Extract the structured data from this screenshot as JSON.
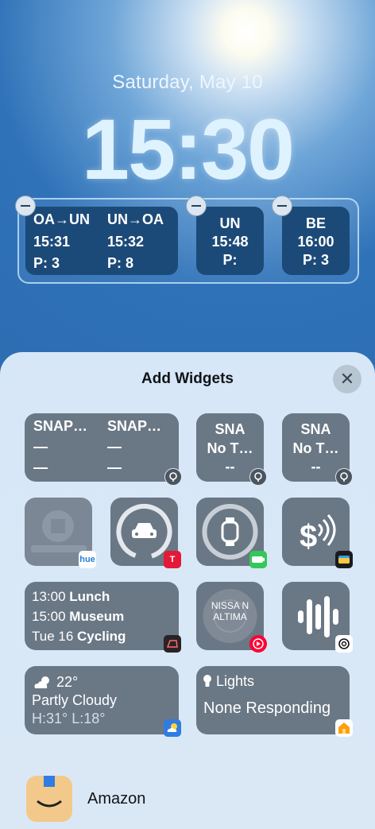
{
  "lock": {
    "date": "Saturday, May 10",
    "time": "15:30",
    "widgets": [
      {
        "cols": [
          [
            "OA→UN",
            "15:31",
            "P: 3"
          ],
          [
            "UN→OA",
            "15:32",
            "P: 8"
          ]
        ]
      },
      {
        "lines": [
          "UN",
          "15:48",
          "P:"
        ]
      },
      {
        "lines": [
          "BE",
          "16:00",
          "P: 3"
        ]
      }
    ]
  },
  "sheet": {
    "title": "Add Widgets",
    "close": "✕",
    "snap_wide": {
      "col1": [
        "SNAP…",
        "—",
        "—"
      ],
      "col2": [
        "SNAP…",
        "—",
        "—"
      ]
    },
    "snap_small1": [
      "SNA",
      "No T…",
      "--"
    ],
    "snap_small2": [
      "SNA",
      "No T…",
      "--"
    ],
    "hue_badge": "hue",
    "calendar": [
      {
        "time": "13:00",
        "event": "Lunch"
      },
      {
        "time": "15:00",
        "event": "Museum"
      },
      {
        "time": "Tue 16",
        "event": "Cycling"
      }
    ],
    "nissan": "NISSA N ALTIMA",
    "weather": {
      "temp": "22°",
      "condition": "Partly Cloudy",
      "hilo": "H:31° L:18°"
    },
    "lights": {
      "title": "Lights",
      "status": "None Responding"
    }
  },
  "amazon": {
    "label": "Amazon"
  },
  "colors": {
    "tesla": "#e31937",
    "battery": "#34c759",
    "youtube_music": "#ff0033",
    "home": "#ff9f0a",
    "weather_badge": "#2f7de1"
  }
}
